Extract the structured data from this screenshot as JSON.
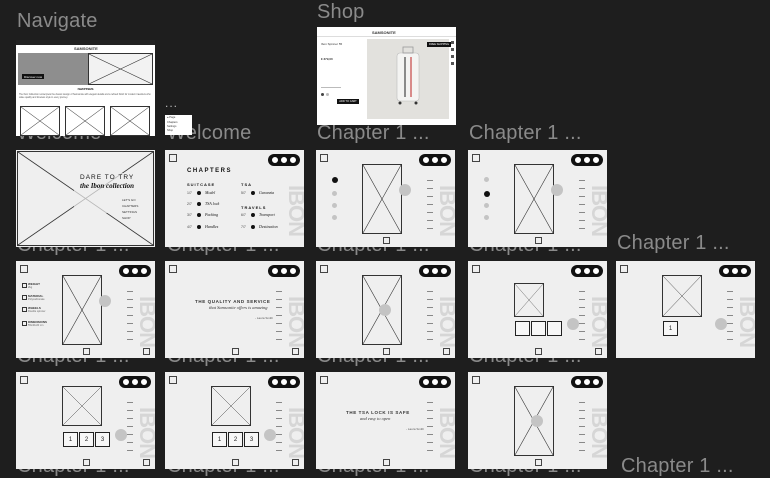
{
  "labels": {
    "navigate": "Navigate",
    "shop": "Shop",
    "welcome": "Welcome",
    "chapter": "Chapter 1 ..."
  },
  "navigate_frame": {
    "brand": "SAMSONITE",
    "cta": "Discover now",
    "body_text": "The Ibon Collection reinterprets the classic design of Samsonite with elegant details and a refined finish for modern travellers who value quality and timeless style in every journey.",
    "tabs": [
      "CHAPTERS",
      "SETTINGS"
    ]
  },
  "popover": {
    "items": [
      "● Page",
      "Chapters",
      "Settings",
      "Shop"
    ]
  },
  "ellipsis": "...",
  "shop_frame": {
    "brand": "SAMSONITE",
    "product_title": "Ibon Spinner 55",
    "price": "€ 379,00",
    "add_button": "ADD TO CART",
    "banner": "FREE SHIPPING"
  },
  "welcome_frame": {
    "title_line1": "DARE TO TRY",
    "title_line2": "the Ibon collection",
    "menu": [
      "LET'S GO",
      "CHAPTERS",
      "SETTINGS",
      "SHOP"
    ]
  },
  "chapters_frame": {
    "title": "CHAPTERS",
    "left_heading": "SUITCASE",
    "right_heading_1": "TSA",
    "right_heading_2": "TRAVELS",
    "left_items": [
      {
        "num": "1/7",
        "label": "Model"
      },
      {
        "num": "2/7",
        "label": "TSA lock"
      },
      {
        "num": "3/7",
        "label": "Packing"
      },
      {
        "num": "4/7",
        "label": "Handles"
      }
    ],
    "right_items": [
      {
        "num": "5/7",
        "label": "Garanzia"
      },
      {
        "num": "6/7",
        "label": "Transport"
      },
      {
        "num": "7/7",
        "label": "Destination"
      }
    ]
  },
  "quote_frame": {
    "line1": "THE QUALITY AND SERVICE",
    "line2": "that Samsonite offers is amazing",
    "author": "- Laura Smith"
  },
  "tsa_frame": {
    "line1": "THE TSA LOCK IS SAFE",
    "line2": "and easy to open",
    "author": "- Laura Smith"
  },
  "features": [
    {
      "title": "WEIGHT",
      "sub": "2kg"
    },
    {
      "title": "MATERIAL",
      "sub": "Polycarbonate"
    },
    {
      "title": "WHEELS",
      "sub": "Double spinner"
    },
    {
      "title": "DIMENSIONS",
      "sub": "55x40x20 cm"
    }
  ],
  "ibon_word": "IBON",
  "step_labels": [
    "1",
    "2",
    "3"
  ],
  "colors": {
    "canvas": "#1e1e1e",
    "frame": "#efefef",
    "label": "#8a8a8a",
    "accent_gray": "#c4c4c4"
  }
}
